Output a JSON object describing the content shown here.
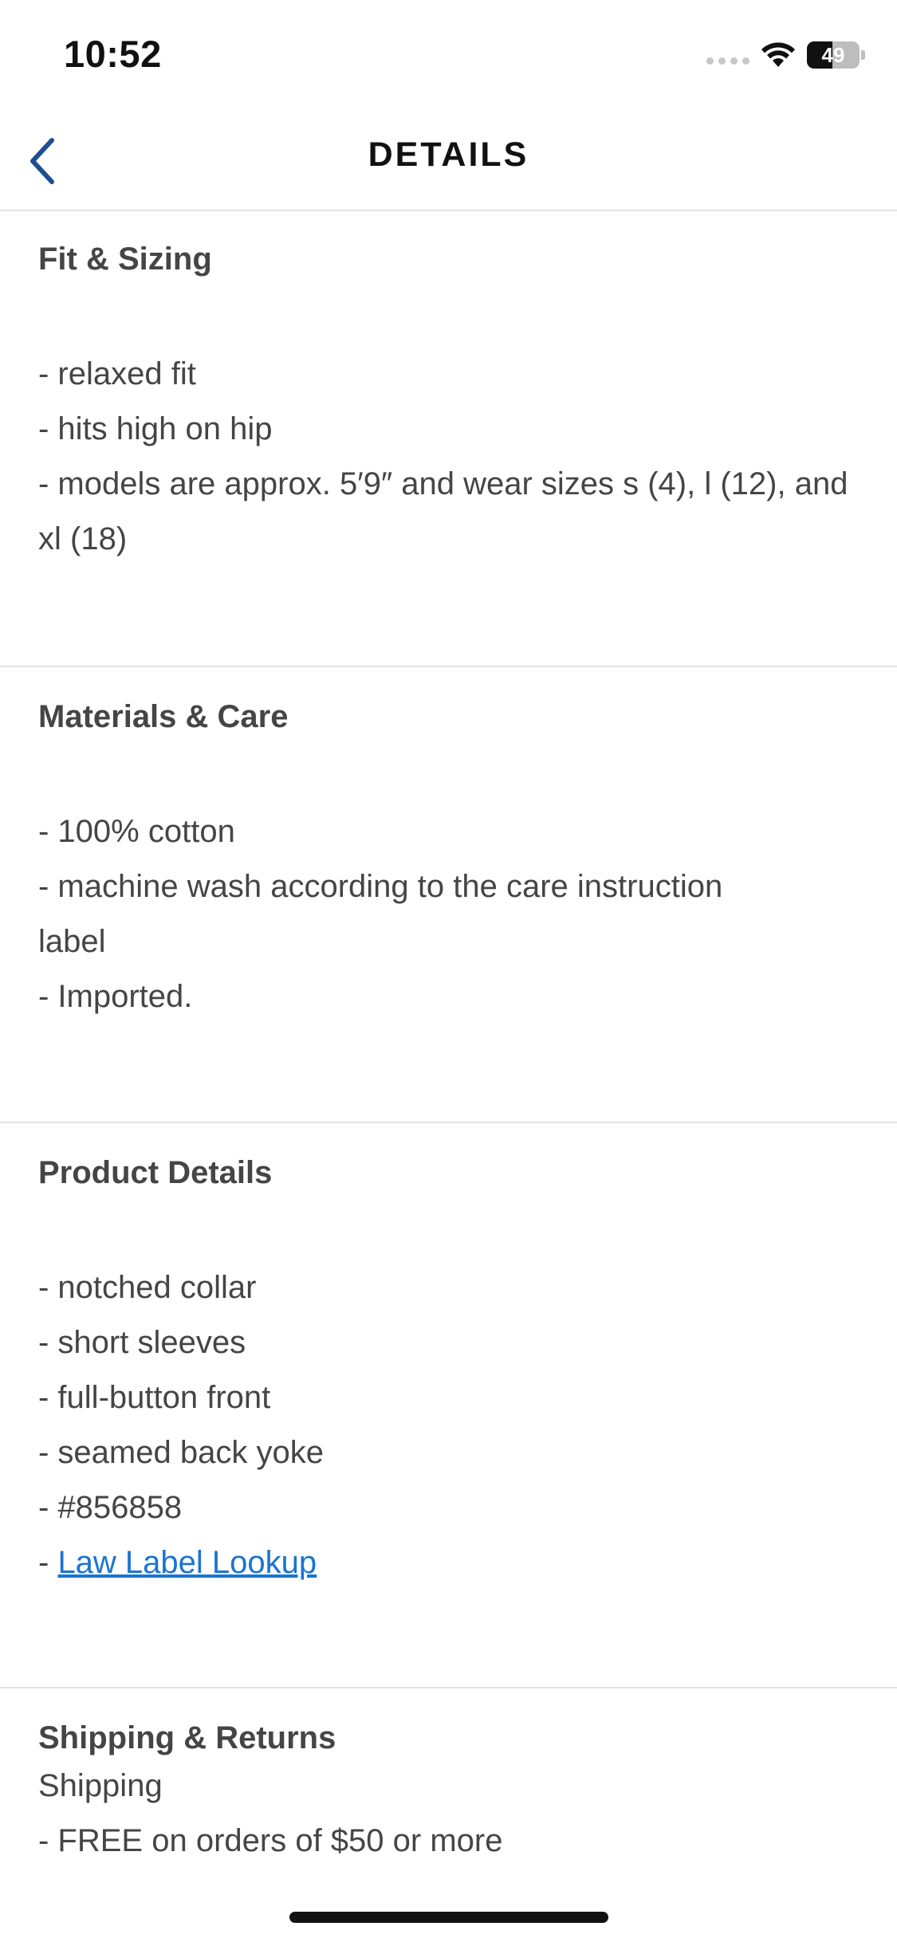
{
  "status_bar": {
    "time": "10:52",
    "battery": "49",
    "battery_level": 0.49
  },
  "nav": {
    "title": "DETAILS",
    "back_icon": "chevron-left-icon",
    "accent_color": "#1d4f91"
  },
  "sections": {
    "fit": {
      "title": "Fit & Sizing",
      "items": [
        "- relaxed fit",
        "- hits high on hip",
        "- models are approx. 5′9″ and wear sizes s (4), l (12), and xl (18)"
      ]
    },
    "materials": {
      "title": "Materials & Care",
      "items": [
        "- 100% cotton",
        "- machine wash according to the care instruction label",
        "- Imported."
      ]
    },
    "product": {
      "title": "Product Details",
      "items": [
        "- notched collar",
        "- short sleeves",
        "- full-button front",
        "- seamed back yoke",
        "- #856858"
      ],
      "link_prefix": "- ",
      "link_label": "Law Label Lookup",
      "link_color": "#1a74d1"
    },
    "shipping": {
      "title": "Shipping & Returns",
      "subtitle": "Shipping",
      "items": [
        "- FREE on orders of $50 or more"
      ]
    }
  }
}
